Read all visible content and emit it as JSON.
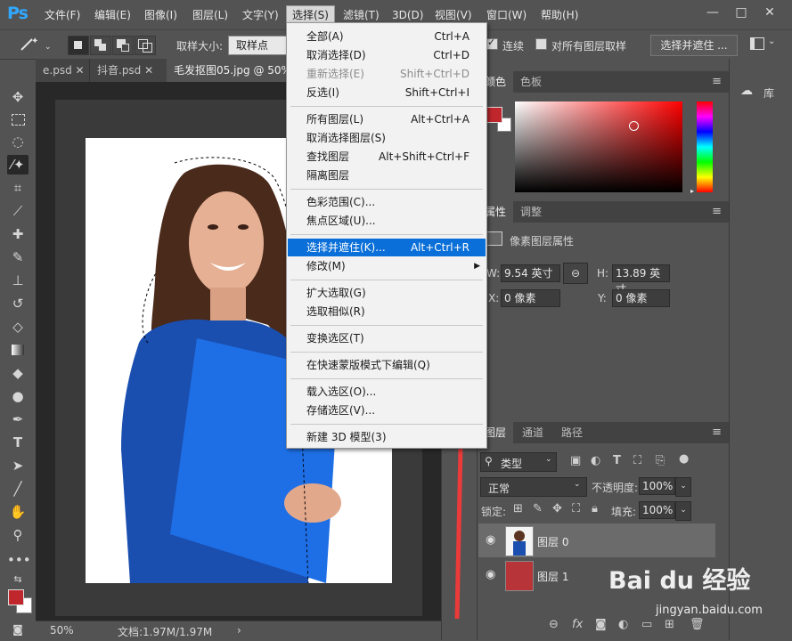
{
  "app": {
    "logo": "Ps"
  },
  "menubar": {
    "items": [
      "文件(F)",
      "编辑(E)",
      "图像(I)",
      "图层(L)",
      "文字(Y)",
      "选择(S)",
      "滤镜(T)",
      "3D(D)",
      "视图(V)",
      "窗口(W)",
      "帮助(H)"
    ],
    "window_controls": [
      "—",
      "□",
      "✕"
    ]
  },
  "options_bar": {
    "sample_size_label": "取样大小:",
    "sample_size_value": "取样点",
    "contiguous_label": "连续",
    "all_layers_label": "对所有图层取样",
    "select_mask_button": "选择并遮住 ..."
  },
  "tabs": [
    {
      "label": "e.psd",
      "active": false
    },
    {
      "label": "抖音.psd",
      "active": false
    },
    {
      "label": "毛发抠图05.jpg @ 50%",
      "active": true
    }
  ],
  "select_menu": {
    "groups": [
      [
        {
          "label": "全部(A)",
          "shortcut": "Ctrl+A",
          "disabled": false
        },
        {
          "label": "取消选择(D)",
          "shortcut": "Ctrl+D",
          "disabled": false
        },
        {
          "label": "重新选择(E)",
          "shortcut": "Shift+Ctrl+D",
          "disabled": true
        },
        {
          "label": "反选(I)",
          "shortcut": "Shift+Ctrl+I",
          "disabled": false
        }
      ],
      [
        {
          "label": "所有图层(L)",
          "shortcut": "Alt+Ctrl+A",
          "disabled": false
        },
        {
          "label": "取消选择图层(S)",
          "shortcut": "",
          "disabled": false
        },
        {
          "label": "查找图层",
          "shortcut": "Alt+Shift+Ctrl+F",
          "disabled": false
        },
        {
          "label": "隔离图层",
          "shortcut": "",
          "disabled": false
        }
      ],
      [
        {
          "label": "色彩范围(C)...",
          "shortcut": "",
          "disabled": false
        },
        {
          "label": "焦点区域(U)...",
          "shortcut": "",
          "disabled": false
        }
      ],
      [
        {
          "label": "选择并遮住(K)...",
          "shortcut": "Alt+Ctrl+R",
          "disabled": false,
          "highlighted": true
        },
        {
          "label": "修改(M)",
          "shortcut": "",
          "disabled": false,
          "submenu": true
        }
      ],
      [
        {
          "label": "扩大选取(G)",
          "shortcut": "",
          "disabled": false
        },
        {
          "label": "选取相似(R)",
          "shortcut": "",
          "disabled": false
        }
      ],
      [
        {
          "label": "变换选区(T)",
          "shortcut": "",
          "disabled": false
        }
      ],
      [
        {
          "label": "在快速蒙版模式下编辑(Q)",
          "shortcut": "",
          "disabled": false
        }
      ],
      [
        {
          "label": "载入选区(O)...",
          "shortcut": "",
          "disabled": false
        },
        {
          "label": "存储选区(V)...",
          "shortcut": "",
          "disabled": false
        }
      ],
      [
        {
          "label": "新建 3D 模型(3)",
          "shortcut": "",
          "disabled": false
        }
      ]
    ]
  },
  "color_panel": {
    "tabs": [
      "颜色",
      "色板"
    ],
    "foreground": "#c0272d",
    "background": "#ffffff"
  },
  "properties_panel": {
    "tabs": [
      "属性",
      "调整"
    ],
    "title": "像素图层属性",
    "w_label": "W:",
    "w_value": "9.54 英寸",
    "h_label": "H:",
    "h_value": "13.89 英寸",
    "x_label": "X:",
    "x_value": "0 像素",
    "y_label": "Y:",
    "y_value": "0 像素"
  },
  "layers_panel": {
    "tabs": [
      "图层",
      "通道",
      "路径"
    ],
    "filter": "类型",
    "blend_mode": "正常",
    "opacity_label": "不透明度:",
    "opacity": "100%",
    "lock_label": "锁定:",
    "fill_label": "填充:",
    "fill": "100%",
    "layers": [
      {
        "name": "图层 0",
        "selected": true,
        "thumb": "photo"
      },
      {
        "name": "图层 1",
        "selected": false,
        "thumb": "#b73438"
      }
    ]
  },
  "right_strip": {
    "library_label": "库"
  },
  "status": {
    "zoom": "50%",
    "doc": "文档:1.97M/1.97M"
  },
  "watermark": {
    "text": "Bai du 经验",
    "url": "jingyan.baidu.com"
  }
}
